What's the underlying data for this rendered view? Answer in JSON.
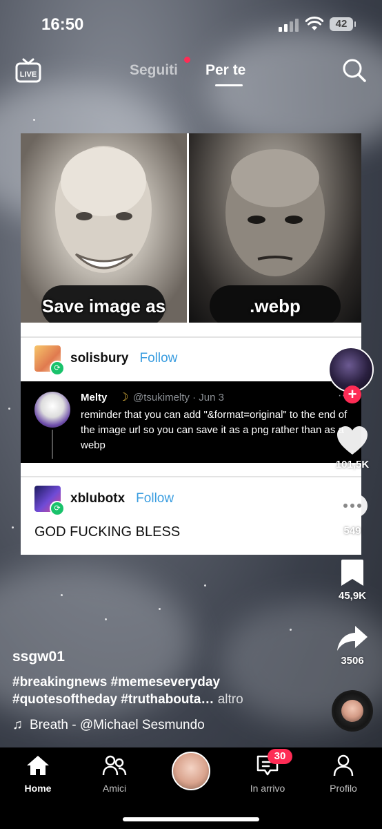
{
  "status_bar": {
    "time": "16:50",
    "battery": "42"
  },
  "top_nav": {
    "live_label": "LIVE",
    "tabs": [
      {
        "label": "Seguiti"
      },
      {
        "label": "Per te"
      }
    ]
  },
  "post": {
    "meme": {
      "left_caption": "Save image as",
      "right_caption": ".webp"
    },
    "first_author": {
      "username": "solisbury",
      "follow_label": "Follow"
    },
    "tweet": {
      "name": "Melty",
      "handle_date": "@tsukimelty · Jun 3",
      "text": "reminder that you can add \"&format=original\" to the end of the image url so you can save it as a png rather than as a webp"
    },
    "second_author": {
      "username": "xblubotx",
      "follow_label": "Follow",
      "text": "GOD FUCKING BLESS"
    }
  },
  "sidebar": {
    "likes": "101,5K",
    "comments": "549",
    "bookmarks": "45,9K",
    "shares": "3506"
  },
  "caption": {
    "author": "ssgw01",
    "hashtags": "#breakingnews #memeseveryday #quotesoftheday #truthabouta…",
    "more_label": "altro",
    "music": "Breath - @Michael Sesmundo"
  },
  "bottom_nav": {
    "items": [
      {
        "label": "Home"
      },
      {
        "label": "Amici"
      },
      {
        "label": "In arrivo",
        "badge": "30"
      },
      {
        "label": "Profilo"
      }
    ]
  },
  "colors": {
    "accent_red": "#fe2c55",
    "link_blue": "#3a9de0",
    "reblog_green": "#19c26b"
  }
}
